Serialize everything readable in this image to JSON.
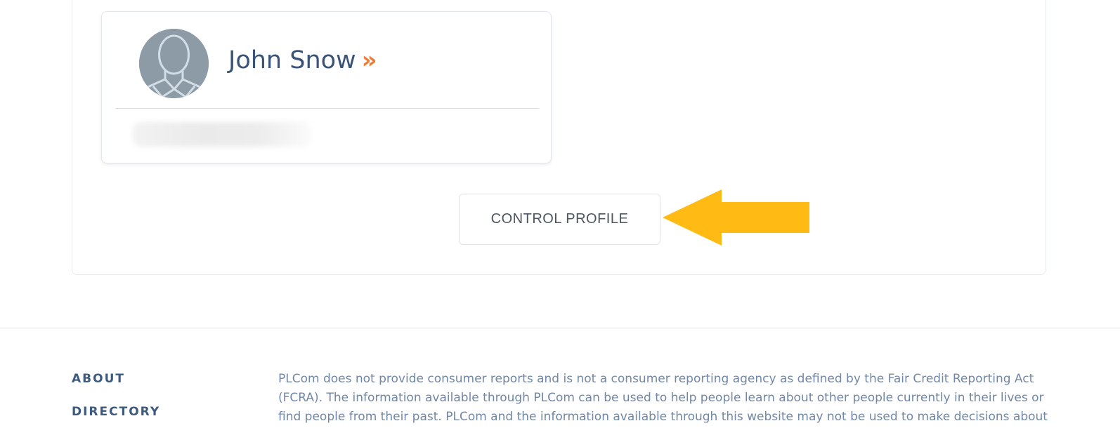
{
  "profile": {
    "name": "John Snow",
    "chevron": "»",
    "avatar_icon": "person-silhouette-icon"
  },
  "control_button": {
    "label": "CONTROL PROFILE"
  },
  "annotation": {
    "arrow_icon": "arrow-left-icon",
    "arrow_color": "#ffbb14"
  },
  "footer": {
    "links": [
      {
        "label": "ABOUT"
      },
      {
        "label": "DIRECTORY"
      }
    ],
    "disclaimer": "PLCom does not provide consumer reports and is not a consumer reporting agency as defined by the Fair Credit Reporting Act (FCRA). The information available through PLCom can be used to help people learn about other people currently in their lives or find people from their past. PLCom and the information available through this website may not be used to make decisions about"
  },
  "colors": {
    "name_text": "#3a5478",
    "chevron": "#f07a31",
    "footer_link": "#3d5a80",
    "disclaimer_text": "#7187a6"
  }
}
